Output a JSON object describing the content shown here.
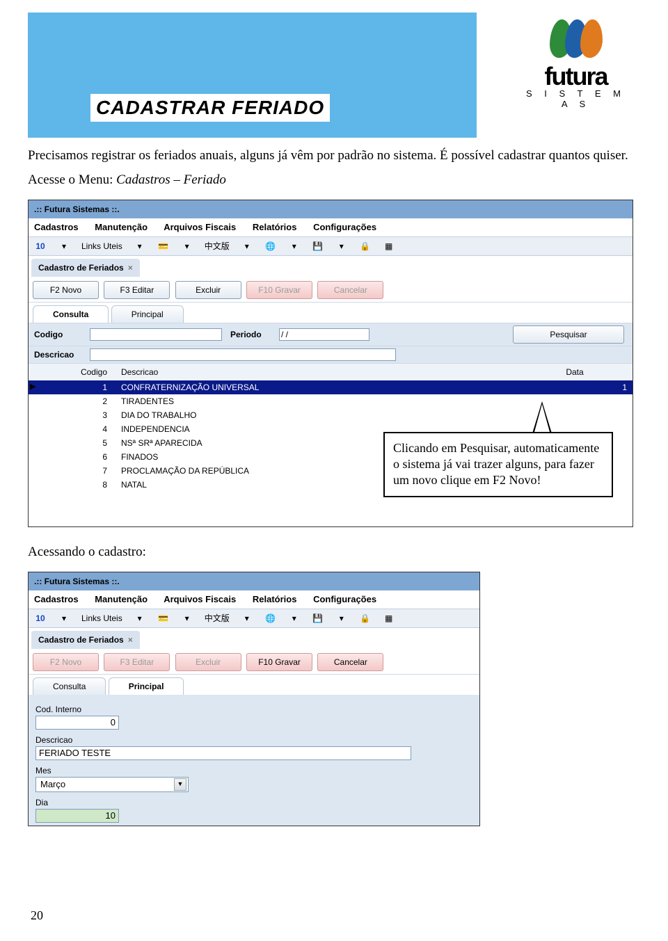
{
  "doc": {
    "section_title": "CADASTRAR FERIADO",
    "intro": "Precisamos registrar os feriados anuais, alguns já vêm por padrão no sistema. É possível cadastrar quantos quiser.",
    "menu_path_prefix": "Acesse o Menu: ",
    "menu_path_italic": "Cadastros – Feriado",
    "callout": "Clicando em Pesquisar, automaticamente o sistema já vai trazer alguns, para fazer um novo clique em F2 Novo!",
    "section2": "Acessando o cadastro:",
    "page_number": "20",
    "logo": {
      "name": "futura",
      "sub": "S I S T E M A S"
    }
  },
  "app": {
    "window_title": ".:: Futura Sistemas ::.",
    "menus": [
      "Cadastros",
      "Manutenção",
      "Arquivos Fiscais",
      "Relatórios",
      "Configurações"
    ],
    "toolbar": {
      "ten": "10",
      "links": "Links Uteis",
      "cjk": "中文版"
    },
    "tab_title": "Cadastro de Feriados",
    "buttons": {
      "novo": "F2 Novo",
      "editar": "F3 Editar",
      "excluir": "Excluir",
      "gravar": "F10 Gravar",
      "cancelar": "Cancelar",
      "pesquisar": "Pesquisar"
    },
    "subtabs": {
      "consulta": "Consulta",
      "principal": "Principal"
    },
    "search": {
      "codigo_label": "Codigo",
      "codigo_value": "",
      "periodo_label": "Periodo",
      "periodo_value": "/ /",
      "descricao_label": "Descricao",
      "descricao_value": ""
    },
    "grid": {
      "headers": {
        "codigo": "Codigo",
        "descricao": "Descricao",
        "data": "Data"
      },
      "rows": [
        {
          "codigo": "1",
          "descricao": "CONFRATERNIZAÇÃO UNIVERSAL",
          "data": "1"
        },
        {
          "codigo": "2",
          "descricao": "TIRADENTES",
          "data": ""
        },
        {
          "codigo": "3",
          "descricao": "DIA DO TRABALHO",
          "data": ""
        },
        {
          "codigo": "4",
          "descricao": "INDEPENDENCIA",
          "data": ""
        },
        {
          "codigo": "5",
          "descricao": "NSª SRª APARECIDA",
          "data": ""
        },
        {
          "codigo": "6",
          "descricao": "FINADOS",
          "data": ""
        },
        {
          "codigo": "7",
          "descricao": "PROCLAMAÇÃO DA REPÚBLICA",
          "data": ""
        },
        {
          "codigo": "8",
          "descricao": "NATAL",
          "data": ""
        }
      ]
    }
  },
  "app2": {
    "form": {
      "cod_label": "Cod. Interno",
      "cod_value": "0",
      "desc_label": "Descricao",
      "desc_value": "FERIADO TESTE",
      "mes_label": "Mes",
      "mes_value": "Março",
      "dia_label": "Dia",
      "dia_value": "10"
    }
  }
}
